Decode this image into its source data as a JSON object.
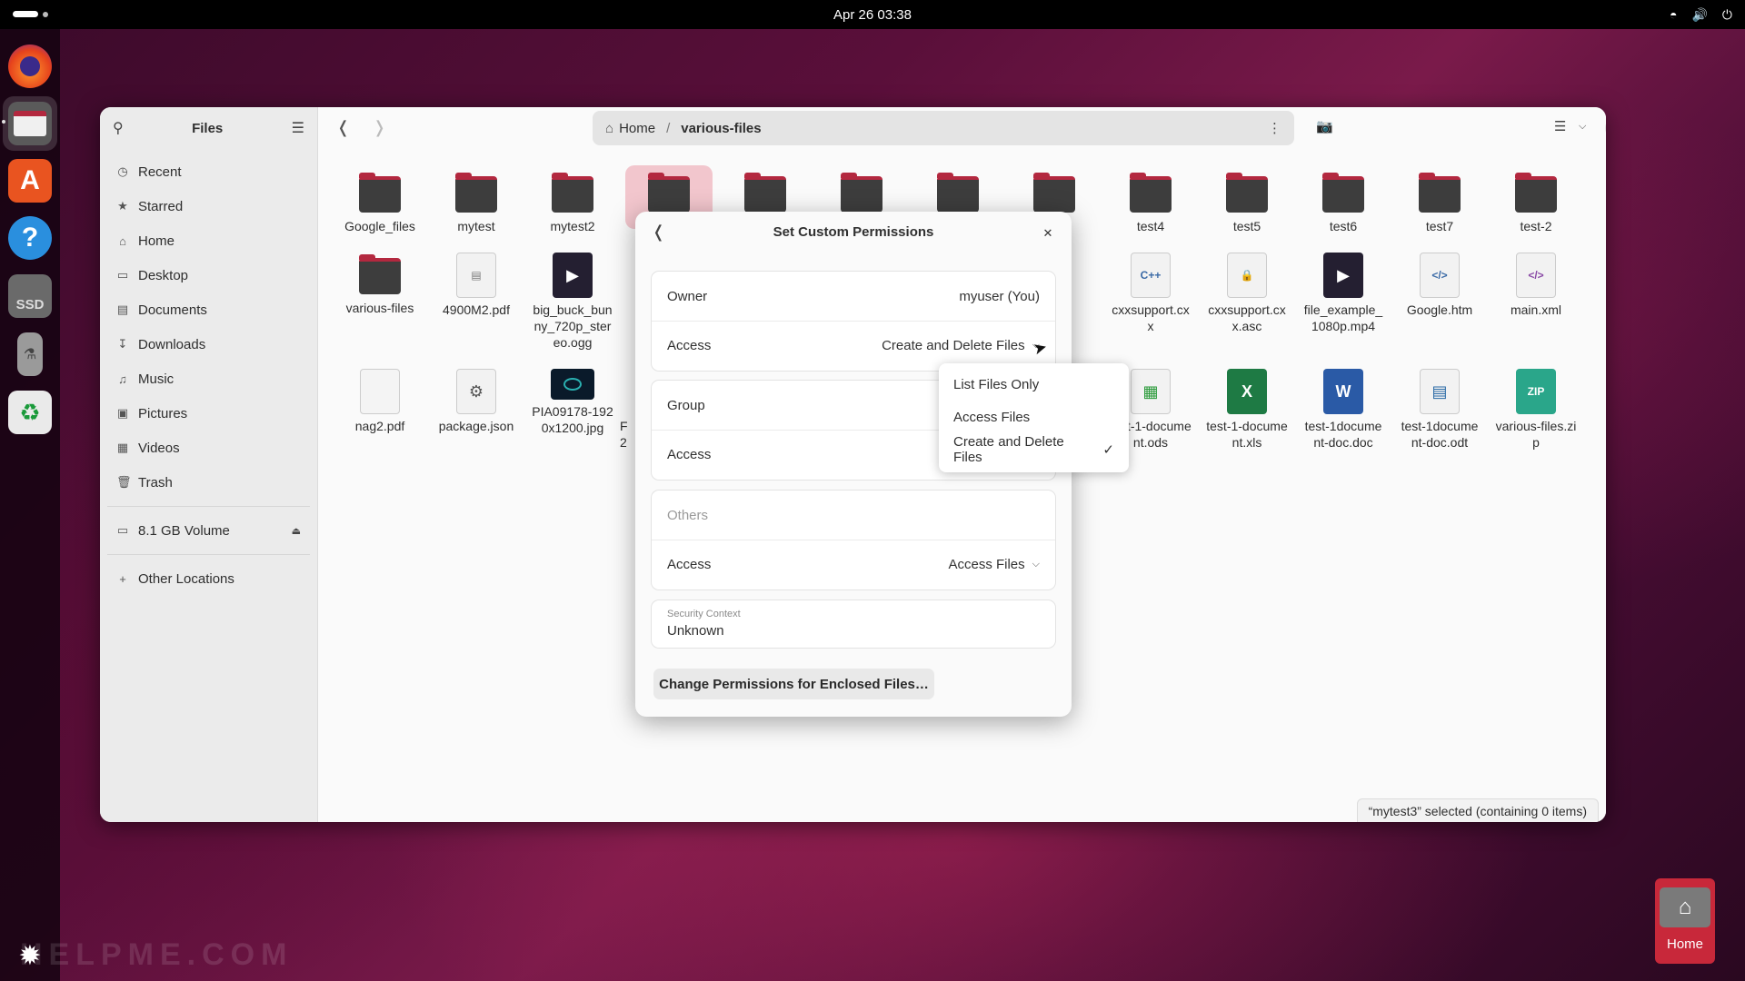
{
  "topbar": {
    "datetime": "Apr 26  03:38"
  },
  "dock": {
    "items": [
      "firefox-icon",
      "files-icon",
      "app-center-icon",
      "help-icon",
      "ssd-drive-icon",
      "usb-drive-icon",
      "trash-recycle-icon",
      "show-apps-icon"
    ],
    "ssd_label": "SSD"
  },
  "sidebar": {
    "title": "Files",
    "items": [
      {
        "label": "Recent",
        "icon": "clock-icon"
      },
      {
        "label": "Starred",
        "icon": "star-icon"
      },
      {
        "label": "Home",
        "icon": "home-icon"
      },
      {
        "label": "Desktop",
        "icon": "desktop-icon"
      },
      {
        "label": "Documents",
        "icon": "document-icon"
      },
      {
        "label": "Downloads",
        "icon": "download-icon"
      },
      {
        "label": "Music",
        "icon": "music-icon"
      },
      {
        "label": "Pictures",
        "icon": "picture-icon"
      },
      {
        "label": "Videos",
        "icon": "video-icon"
      },
      {
        "label": "Trash",
        "icon": "trash-icon"
      }
    ],
    "volume": "8.1 GB Volume",
    "other_locations": "Other Locations"
  },
  "pathbar": {
    "home": "Home",
    "current": "various-files"
  },
  "files": [
    {
      "name": "Google_files",
      "kind": "folder"
    },
    {
      "name": "mytest",
      "kind": "folder"
    },
    {
      "name": "mytest2",
      "kind": "folder"
    },
    {
      "name": "test4",
      "kind": "folder"
    },
    {
      "name": "test5",
      "kind": "folder"
    },
    {
      "name": "test6",
      "kind": "folder"
    },
    {
      "name": "test7",
      "kind": "folder"
    },
    {
      "name": "test-2",
      "kind": "folder"
    },
    {
      "name": "various-files",
      "kind": "folder"
    },
    {
      "name": "4900M2.pdf",
      "kind": "pdf"
    },
    {
      "name": "big_buck_bunny_720p_stereo.ogg",
      "kind": "video"
    },
    {
      "name": "cxxsupport.cxx",
      "kind": "cpp"
    },
    {
      "name": "cxxsupport.cxx.asc",
      "kind": "pgp"
    },
    {
      "name": "file_example_1080p.mp4",
      "kind": "video"
    },
    {
      "name": "Google.htm",
      "kind": "html"
    },
    {
      "name": "main.xml",
      "kind": "xml"
    },
    {
      "name": "nag2.pdf",
      "kind": "pdf"
    },
    {
      "name": "package.json",
      "kind": "json"
    },
    {
      "name": "PIA09178-1920x1200.jpg",
      "kind": "image"
    },
    {
      "name": "test-1-document.ods",
      "kind": "spreadsheet"
    },
    {
      "name": "test-1-document.xls",
      "kind": "excel"
    },
    {
      "name": "test-1document-doc.doc",
      "kind": "word"
    },
    {
      "name": "test-1document-doc.odt",
      "kind": "text"
    },
    {
      "name": "various-files.zip",
      "kind": "zip"
    }
  ],
  "partial_labels": {
    "sio": "sio",
    "c": "c",
    "cument": "cument.o",
    "ds": "ds",
    "F": "F",
    "two": "2",
    "C": "C"
  },
  "dialog": {
    "title": "Set Custom Permissions",
    "owner_label": "Owner",
    "owner_value": "myuser (You)",
    "owner_access_label": "Access",
    "owner_access_value": "Create and Delete Files",
    "group_label": "Group",
    "group_access_label": "Access",
    "others_label": "Others",
    "others_access_label": "Access",
    "others_access_value": "Access Files",
    "security_label": "Security Context",
    "security_value": "Unknown",
    "enclosed_button": "Change Permissions for Enclosed Files…"
  },
  "popover": {
    "options": [
      "List Files Only",
      "Access Files",
      "Create and Delete Files"
    ],
    "selected": "Create and Delete Files"
  },
  "status": "“mytest3” selected  (containing 0 items)",
  "watermark": "HELPME.COM",
  "desktop_home_label": "Home"
}
